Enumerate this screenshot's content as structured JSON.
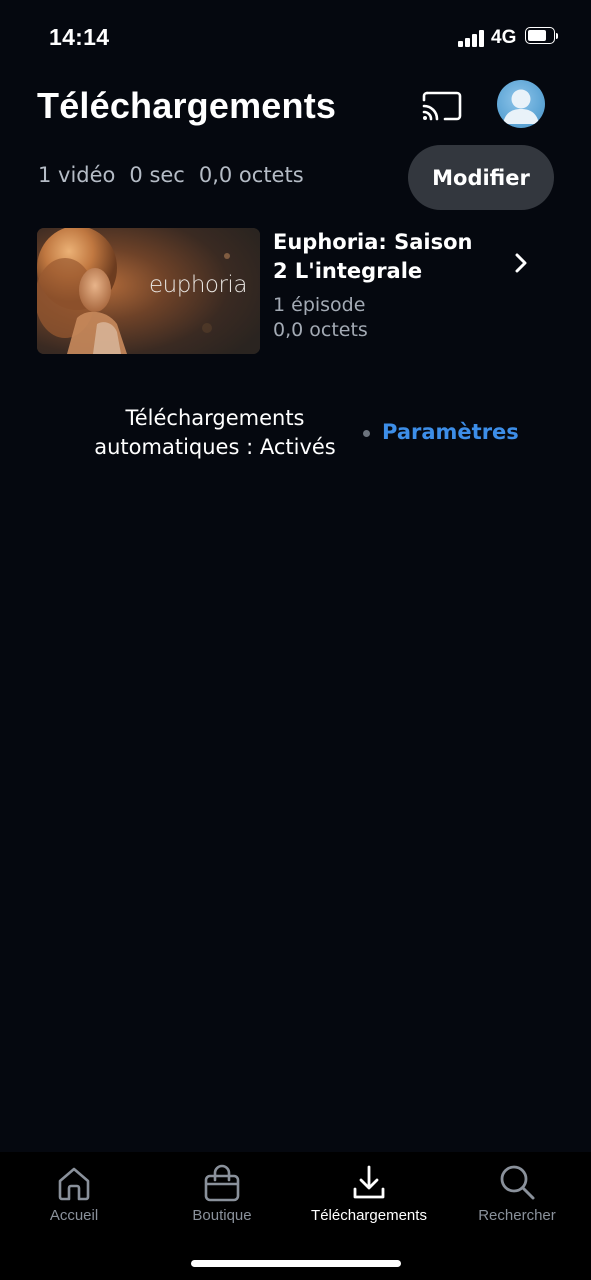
{
  "status_bar": {
    "time": "14:14",
    "network": "4G",
    "battery_level": 0.75
  },
  "header": {
    "title": "Téléchargements",
    "cast_icon": "cast-icon",
    "avatar_icon": "user-avatar-icon"
  },
  "summary": {
    "videos": "1 vidéo",
    "duration": "0 sec",
    "size": "0,0 octets",
    "edit_label": "Modifier"
  },
  "downloads": [
    {
      "thumbnail_text": "euphoria",
      "title": "Euphoria: Saison 2 L'integrale",
      "episodes": "1 épisode",
      "size": "0,0 octets"
    }
  ],
  "auto_downloads": {
    "status_text": "Téléchargements automatiques : Activés",
    "settings_label": "Paramètres",
    "link_color": "#3d8ee8"
  },
  "bottom_nav": {
    "items": [
      {
        "label": "Accueil",
        "icon": "home-icon"
      },
      {
        "label": "Boutique",
        "icon": "shopping-bag-icon"
      },
      {
        "label": "Téléchargements",
        "icon": "download-icon",
        "active": true
      },
      {
        "label": "Rechercher",
        "icon": "search-icon"
      }
    ]
  }
}
